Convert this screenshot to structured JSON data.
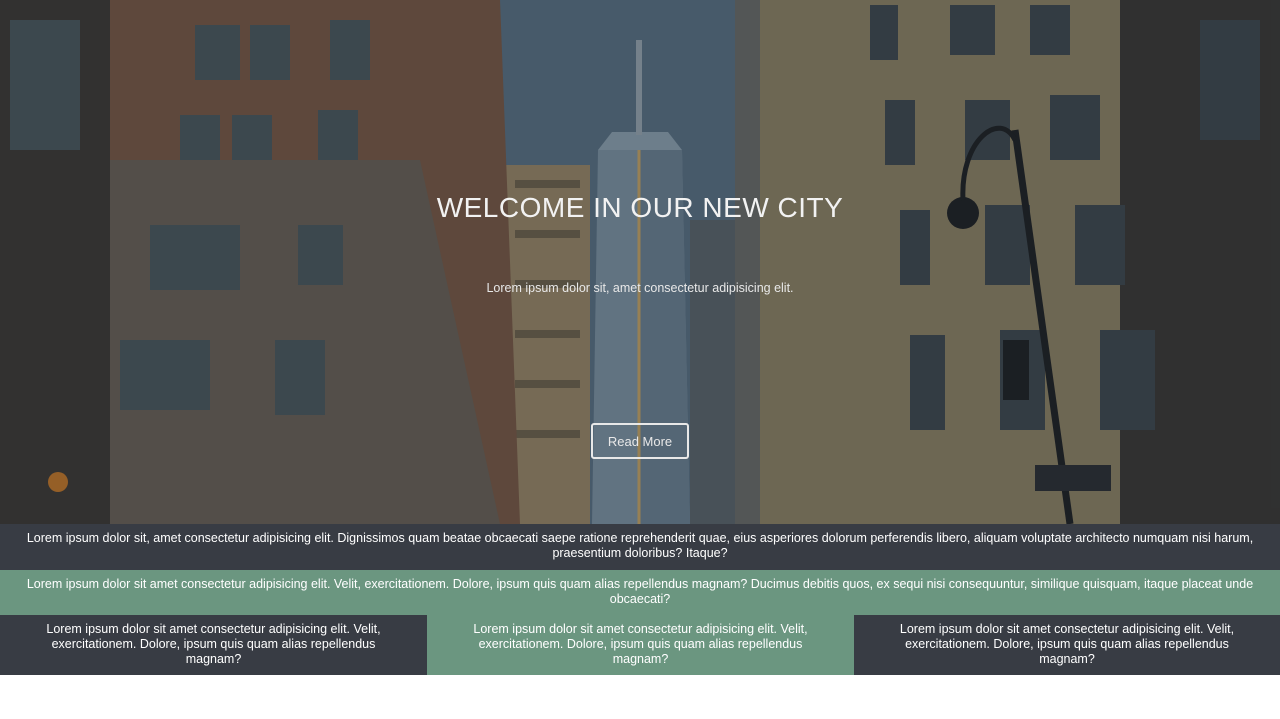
{
  "hero": {
    "title": "WELCOME IN OUR NEW CITY",
    "subtitle": "Lorem ipsum dolor sit, amet consectetur adipisicing elit.",
    "button_label": "Read More",
    "background_image": "city-street-skyscraper-photo"
  },
  "band_dark": {
    "text": "Lorem ipsum dolor sit, amet consectetur adipisicing elit. Dignissimos quam beatae obcaecati saepe ratione reprehenderit quae, eius asperiores dolorum perferendis libero, aliquam voluptate architecto numquam nisi harum, praesentium doloribus? Itaque?"
  },
  "band_green": {
    "text": "Lorem ipsum dolor sit amet consectetur adipisicing elit. Velit, exercitationem. Dolore, ipsum quis quam alias repellendus magnam? Ducimus debitis quos, ex sequi nisi consequuntur, similique quisquam, itaque placeat unde obcaecati?"
  },
  "columns": [
    {
      "text": "Lorem ipsum dolor sit amet consectetur adipisicing elit. Velit, exercitationem. Dolore, ipsum quis quam alias repellendus magnam?"
    },
    {
      "text": "Lorem ipsum dolor sit amet consectetur adipisicing elit. Velit, exercitationem. Dolore, ipsum quis quam alias repellendus magnam?"
    },
    {
      "text": "Lorem ipsum dolor sit amet consectetur adipisicing elit. Velit, exercitationem. Dolore, ipsum quis quam alias repellendus magnam?"
    }
  ],
  "colors": {
    "dark": "#383c44",
    "green": "#6b9680",
    "text": "#ffffff"
  }
}
